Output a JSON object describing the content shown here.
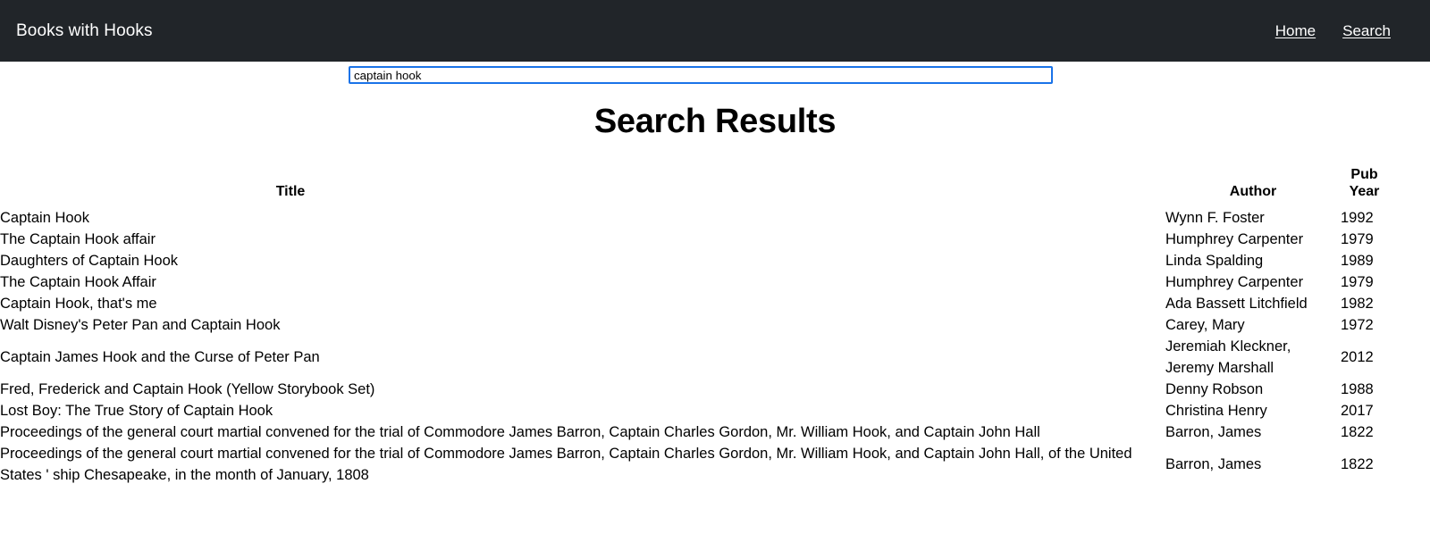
{
  "navbar": {
    "brand": "Books with Hooks",
    "links": [
      {
        "label": "Home"
      },
      {
        "label": "Search"
      }
    ]
  },
  "search": {
    "value": "captain hook",
    "placeholder": "Search"
  },
  "main": {
    "heading": "Search Results",
    "columns": {
      "title": "Title",
      "author": "Author",
      "year": "Pub Year"
    },
    "rows": [
      {
        "title": "Captain Hook",
        "author": "Wynn F. Foster",
        "year": "1992"
      },
      {
        "title": "The Captain Hook affair",
        "author": "Humphrey Carpenter",
        "year": "1979"
      },
      {
        "title": "Daughters of Captain Hook",
        "author": "Linda Spalding",
        "year": "1989"
      },
      {
        "title": "The Captain Hook Affair",
        "author": "Humphrey Carpenter",
        "year": "1979"
      },
      {
        "title": "Captain Hook, that's me",
        "author": "Ada Bassett Litchfield",
        "year": "1982"
      },
      {
        "title": "Walt Disney's Peter Pan and Captain Hook",
        "author": "Carey, Mary",
        "year": "1972"
      },
      {
        "title": "Captain James Hook and the Curse of Peter Pan",
        "author": "Jeremiah Kleckner, Jeremy Marshall",
        "year": "2012"
      },
      {
        "title": "Fred, Frederick and Captain Hook (Yellow Storybook Set)",
        "author": "Denny Robson",
        "year": "1988"
      },
      {
        "title": "Lost Boy: The True Story of Captain Hook",
        "author": "Christina Henry",
        "year": "2017"
      },
      {
        "title": "Proceedings of the general court martial convened for the trial of Commodore James Barron, Captain Charles Gordon, Mr. William Hook, and Captain John Hall",
        "author": "Barron, James",
        "year": "1822"
      },
      {
        "title": "Proceedings of the general court martial convened for the trial of Commodore James Barron, Captain Charles Gordon, Mr. William Hook, and Captain John Hall, of the United States ' ship Chesapeake, in the month of January, 1808",
        "author": "Barron, James",
        "year": "1822"
      }
    ]
  },
  "colors": {
    "navbar_background": "#212529",
    "navbar_text": "#ffffff",
    "page_background": "#ffffff",
    "body_text": "#000000",
    "input_focus_border": "#1a73e8"
  }
}
